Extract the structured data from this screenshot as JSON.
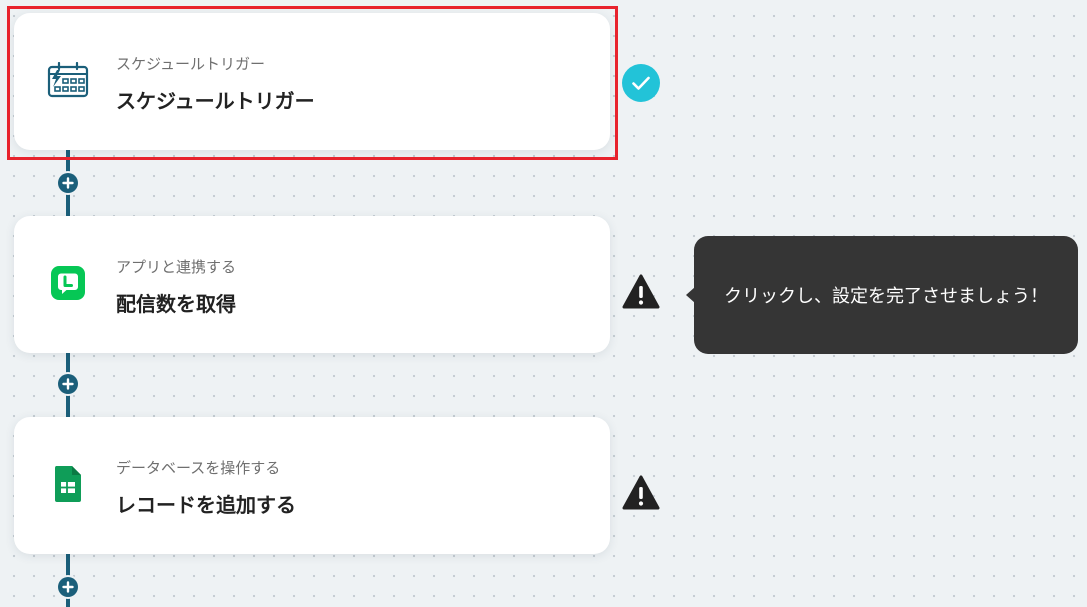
{
  "flow": {
    "steps": [
      {
        "subtitle": "スケジュールトリガー",
        "title": "スケジュールトリガー",
        "icon": "schedule-calendar-icon",
        "status": "complete"
      },
      {
        "subtitle": "アプリと連携する",
        "title": "配信数を取得",
        "icon": "line-app-icon",
        "status": "warning"
      },
      {
        "subtitle": "データベースを操作する",
        "title": "レコードを追加する",
        "icon": "google-sheets-icon",
        "status": "warning"
      }
    ]
  },
  "tooltip": {
    "text": "クリックし、設定を完了させましょう！"
  },
  "colors": {
    "connector": "#1b5f7a",
    "selection": "#e8232d",
    "complete": "#22c3d8",
    "warning": "#222222",
    "line_brand": "#06c755",
    "sheets_brand": "#0f9d58"
  }
}
